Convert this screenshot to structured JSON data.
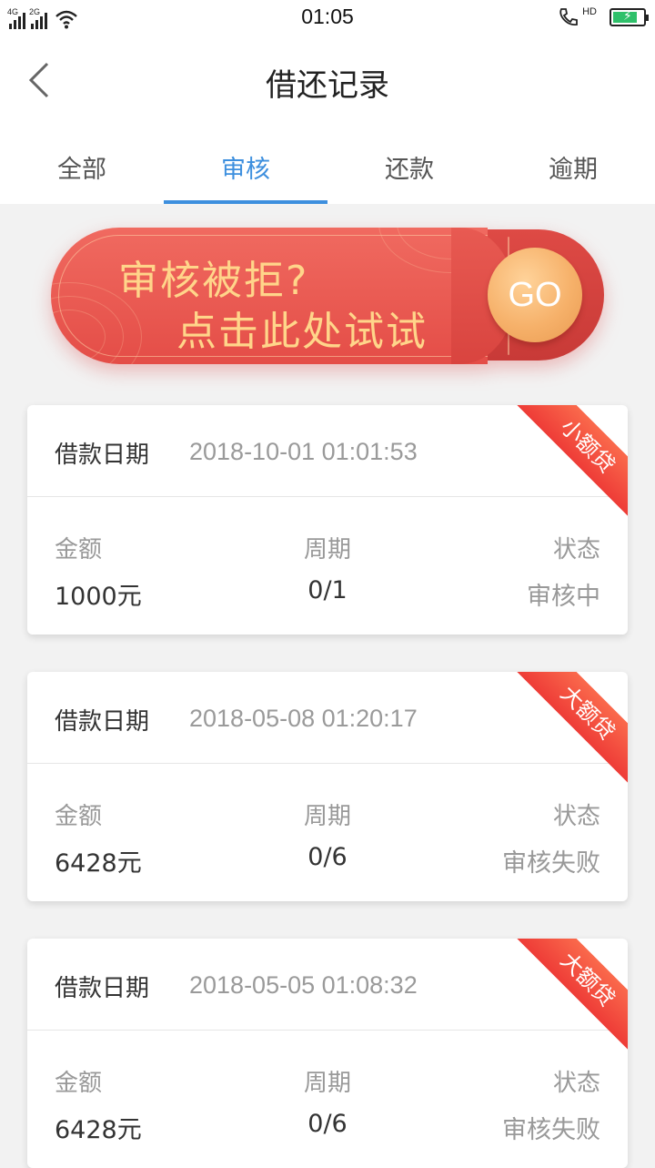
{
  "status_bar": {
    "network1": "4G",
    "network2": "2G",
    "time": "01:05",
    "hd": "HD"
  },
  "nav": {
    "title": "借还记录"
  },
  "tabs": [
    {
      "label": "全部",
      "active": false
    },
    {
      "label": "审核",
      "active": true
    },
    {
      "label": "还款",
      "active": false
    },
    {
      "label": "逾期",
      "active": false
    }
  ],
  "banner": {
    "line1": "审核被拒?",
    "line2": "点击此处试试",
    "go_label": "GO"
  },
  "records": [
    {
      "date_label": "借款日期",
      "date": "2018-10-01 01:01:53",
      "ribbon": "小额贷",
      "amount_label": "金额",
      "amount": "1000元",
      "period_label": "周期",
      "period": "0/1",
      "status_label": "状态",
      "status": "审核中"
    },
    {
      "date_label": "借款日期",
      "date": "2018-05-08 01:20:17",
      "ribbon": "大额贷",
      "amount_label": "金额",
      "amount": "6428元",
      "period_label": "周期",
      "period": "0/6",
      "status_label": "状态",
      "status": "审核失败"
    },
    {
      "date_label": "借款日期",
      "date": "2018-05-05 01:08:32",
      "ribbon": "大额贷",
      "amount_label": "金额",
      "amount": "6428元",
      "period_label": "周期",
      "period": "0/6",
      "status_label": "状态",
      "status": "审核失败"
    }
  ],
  "colors": {
    "accent": "#3d8fde",
    "banner_red": "#e44d47",
    "banner_text": "#ffd58a",
    "ribbon": "#f2483d"
  }
}
